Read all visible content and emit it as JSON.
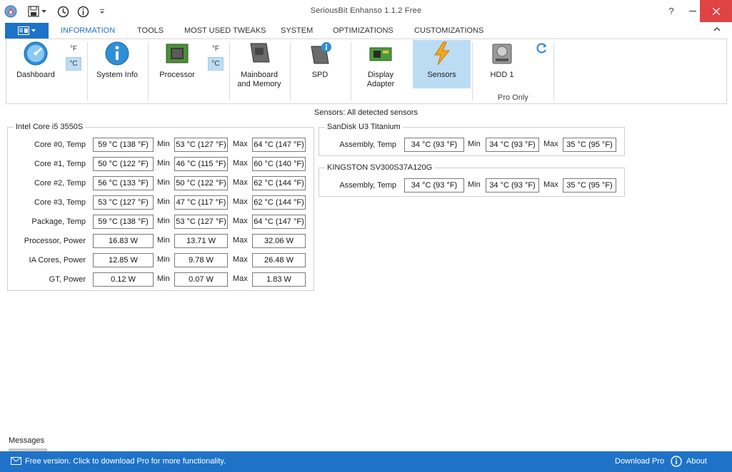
{
  "window": {
    "title": "SeriousBit Enhanso 1.1.2 Free"
  },
  "menu": {
    "tabs": [
      "INFORMATION",
      "TOOLS",
      "MOST USED TWEAKS",
      "SYSTEM",
      "OPTIMIZATIONS",
      "CUSTOMIZATIONS"
    ],
    "active": "INFORMATION"
  },
  "ribbon": {
    "dashboard": "Dashboard",
    "system_info": "System Info",
    "processor": "Processor",
    "mainboard_line1": "Mainboard",
    "mainboard_line2": "and Memory",
    "spd": "SPD",
    "display_line1": "Display",
    "display_line2": "Adapter",
    "sensors": "Sensors",
    "hdd": "HDD 1",
    "pro_only": "Pro Only",
    "unit_f": "°F",
    "unit_c": "°C"
  },
  "subtitle": "Sensors: All detected sensors",
  "labels": {
    "min": "Min",
    "max": "Max"
  },
  "cpu_group": {
    "title": "Intel Core i5 3550S",
    "rows": [
      {
        "label": "Core #0, Temp",
        "current": "59 °C (138 °F)",
        "min": "53 °C (127 °F)",
        "max": "64 °C (147 °F)"
      },
      {
        "label": "Core #1, Temp",
        "current": "50 °C (122 °F)",
        "min": "46 °C (115 °F)",
        "max": "60 °C (140 °F)"
      },
      {
        "label": "Core #2, Temp",
        "current": "56 °C (133 °F)",
        "min": "50 °C (122 °F)",
        "max": "62 °C (144 °F)"
      },
      {
        "label": "Core #3, Temp",
        "current": "53 °C (127 °F)",
        "min": "47 °C (117 °F)",
        "max": "62 °C (144 °F)"
      },
      {
        "label": "Package, Temp",
        "current": "59 °C (138 °F)",
        "min": "53 °C (127 °F)",
        "max": "64 °C (147 °F)"
      },
      {
        "label": "Processor, Power",
        "current": "16.83 W",
        "min": "13.71 W",
        "max": "32.06 W"
      },
      {
        "label": "IA Cores, Power",
        "current": "12.85 W",
        "min": "9.78 W",
        "max": "26.48 W"
      },
      {
        "label": "GT, Power",
        "current": "0.12 W",
        "min": "0.07 W",
        "max": "1.83 W"
      }
    ]
  },
  "disk_groups": [
    {
      "title": "SanDisk U3 Titanium",
      "row": {
        "label": "Assembly, Temp",
        "current": "34 °C (93 °F)",
        "min": "34 °C (93 °F)",
        "max": "35 °C (95 °F)"
      }
    },
    {
      "title": "KINGSTON SV300S37A120G",
      "row": {
        "label": "Assembly, Temp",
        "current": "34 °C (93 °F)",
        "min": "34 °C (93 °F)",
        "max": "35 °C (95 °F)"
      }
    }
  ],
  "messages": {
    "tab": "Messages"
  },
  "status": {
    "text": "Free version. Click to download Pro for more functionality.",
    "download_pro": "Download Pro",
    "about": "About"
  },
  "colors": {
    "accent": "#1e73c8",
    "selected": "#bcdcf4"
  }
}
